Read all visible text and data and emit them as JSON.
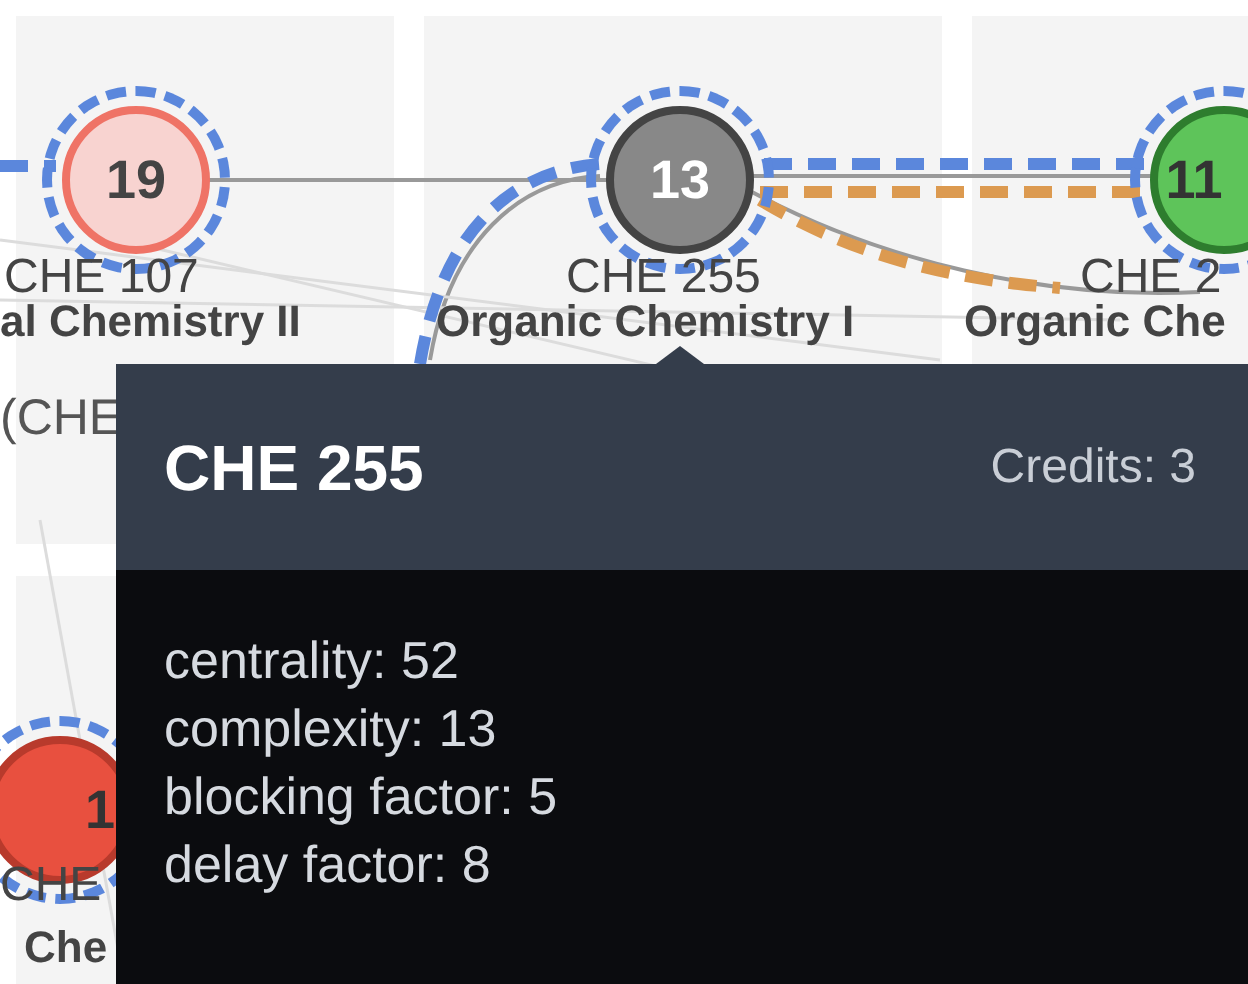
{
  "graph": {
    "nodes": [
      {
        "complexity": "19",
        "code": "CHE 107",
        "name": "al Chemistry II",
        "extra": "(CHE",
        "color": "#f8d3d0",
        "highlighted": true
      },
      {
        "complexity": "13",
        "code": "CHE 255",
        "name": "Organic Chemistry I",
        "color": "#888888",
        "highlighted": true
      },
      {
        "complexity": "11",
        "code": "CHE 2",
        "name": "Organic Che",
        "color": "#5ec45a",
        "highlighted": true
      },
      {
        "complexity": "1",
        "code": "CHE",
        "name": "Che",
        "color": "#e8503f",
        "highlighted": true
      }
    ]
  },
  "tooltip": {
    "title": "CHE 255",
    "credits": "Credits: 3",
    "lines": [
      "centrality: 52",
      "complexity: 13",
      "blocking factor: 5",
      "delay factor: 8"
    ]
  }
}
